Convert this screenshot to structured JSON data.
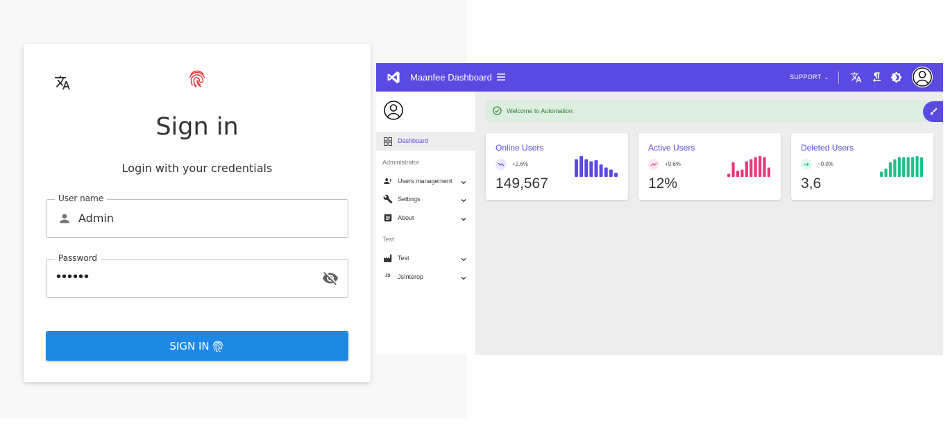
{
  "login": {
    "title": "Sign in",
    "subtitle": "Login with your credentials",
    "username": {
      "label": "User name",
      "value": "Admin"
    },
    "password": {
      "label": "Password",
      "value": "••••••"
    },
    "submit_label": "SIGN IN",
    "icons": {
      "translate": "translate-icon",
      "logo": "fingerprint-icon",
      "user": "person-icon",
      "visibility": "eye-off-icon"
    },
    "colors": {
      "button": "#1e88e5",
      "logo": "#e53935"
    }
  },
  "dashboard": {
    "app_title": "Maanfee Dashboard",
    "appbar": {
      "support_label": "SUPPORT",
      "icons": [
        "menu-icon",
        "translate-icon",
        "rtl-icon",
        "theme-icon",
        "account-icon"
      ]
    },
    "nav": {
      "dashboard": "Dashboard",
      "section_admin": "Administrator",
      "users_management": "Users management",
      "settings": "Settings",
      "about": "About",
      "section_test": "Test",
      "test": "Test",
      "jsinterop": "JsInterop",
      "jsinterop_icon_text": "JS"
    },
    "alert": "Welcome to Automation",
    "cards": [
      {
        "title": "Online Users",
        "trend": "+2.6%",
        "value": "149,567",
        "color": "#594ae2",
        "bars": [
          0.85,
          1.0,
          0.85,
          0.75,
          0.8,
          0.6,
          0.45,
          0.35,
          0.2
        ]
      },
      {
        "title": "Active Users",
        "trend": "+9.6%",
        "value": "12%",
        "color": "#f0357a",
        "bars": [
          0.15,
          0.7,
          0.3,
          0.35,
          0.75,
          0.85,
          0.95,
          1.0,
          0.95,
          0.45
        ]
      },
      {
        "title": "Deleted Users",
        "trend": "~0.0%",
        "value": "3,6",
        "color": "#1ec28b",
        "bars": [
          0.25,
          0.4,
          0.7,
          0.85,
          0.95,
          0.95,
          0.95,
          0.95,
          1.0,
          0.95
        ]
      }
    ],
    "colors": {
      "primary": "#594ae2",
      "alert_bg": "#dbeee0",
      "alert_text": "#2e7d32"
    }
  }
}
